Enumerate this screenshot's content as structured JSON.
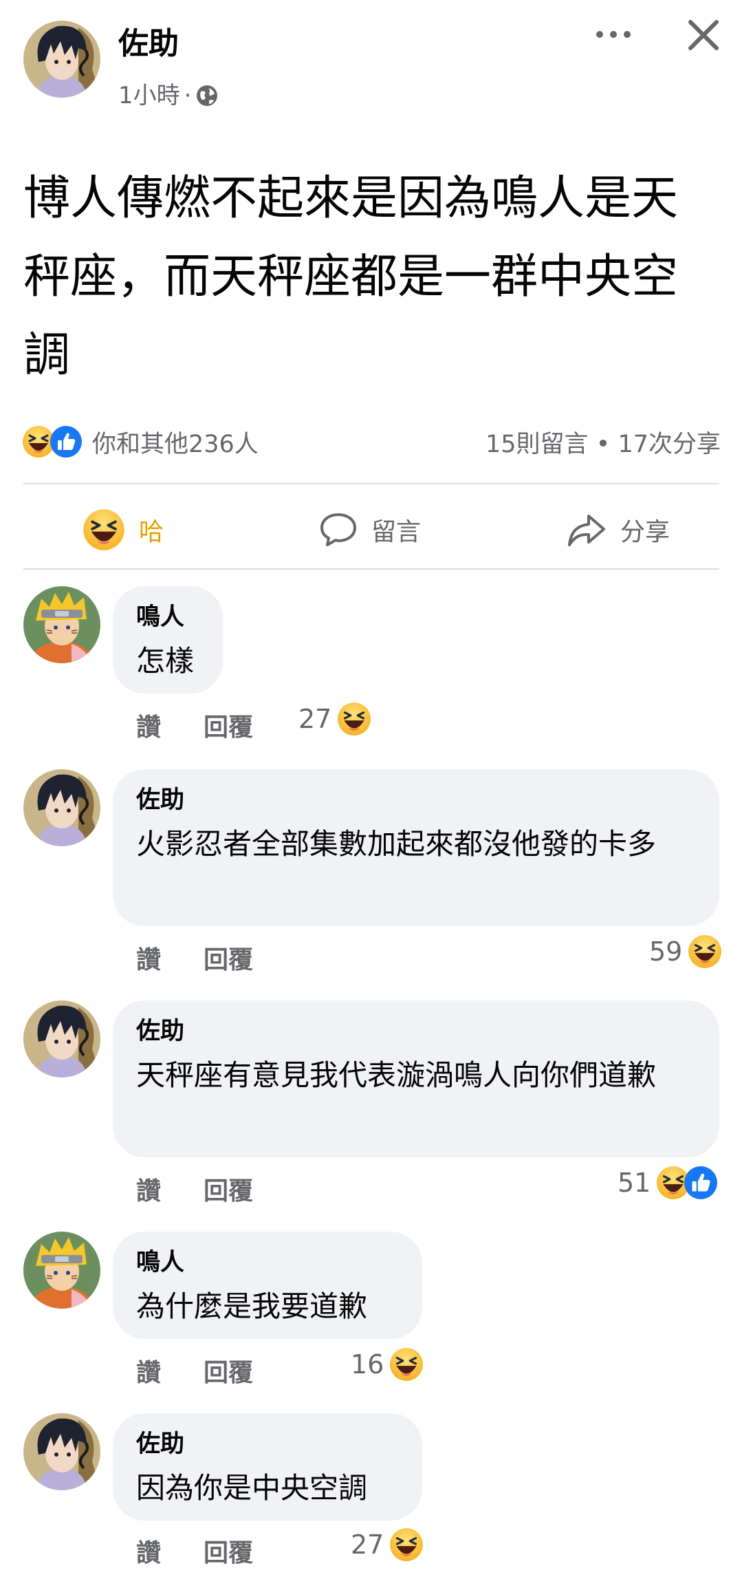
{
  "post": {
    "author": "佐助",
    "time": "1小時",
    "separator": "·",
    "text": "博人傳燃不起來是因為鳴人是天秤座，而天秤座都是一群中央空調"
  },
  "summary": {
    "reactions_text": "你和其他236人",
    "comments_text": "15則留言",
    "dot": "•",
    "shares_text": "17次分享"
  },
  "actions": {
    "haha_label": "哈",
    "comment_label": "留言",
    "share_label": "分享"
  },
  "comments": [
    {
      "author": "鳴人",
      "text": "怎樣",
      "like_label": "讚",
      "reply_label": "回覆",
      "count": "27"
    },
    {
      "author": "佐助",
      "text": "火影忍者全部集數加起來都沒他發的卡多",
      "like_label": "讚",
      "reply_label": "回覆",
      "count": "59"
    },
    {
      "author": "佐助",
      "text": "天秤座有意見我代表漩渦鳴人向你們道歉",
      "like_label": "讚",
      "reply_label": "回覆",
      "count": "51"
    },
    {
      "author": "鳴人",
      "text": "為什麼是我要道歉",
      "like_label": "讚",
      "reply_label": "回覆",
      "count": "16"
    },
    {
      "author": "佐助",
      "text": "因為你是中央空調",
      "like_label": "讚",
      "reply_label": "回覆",
      "count": "27"
    }
  ],
  "colors": {
    "haha_accent": "#e9a100",
    "like_blue": "#1877f2",
    "bubble_bg": "#f0f2f5",
    "secondary_text": "#65676b"
  }
}
